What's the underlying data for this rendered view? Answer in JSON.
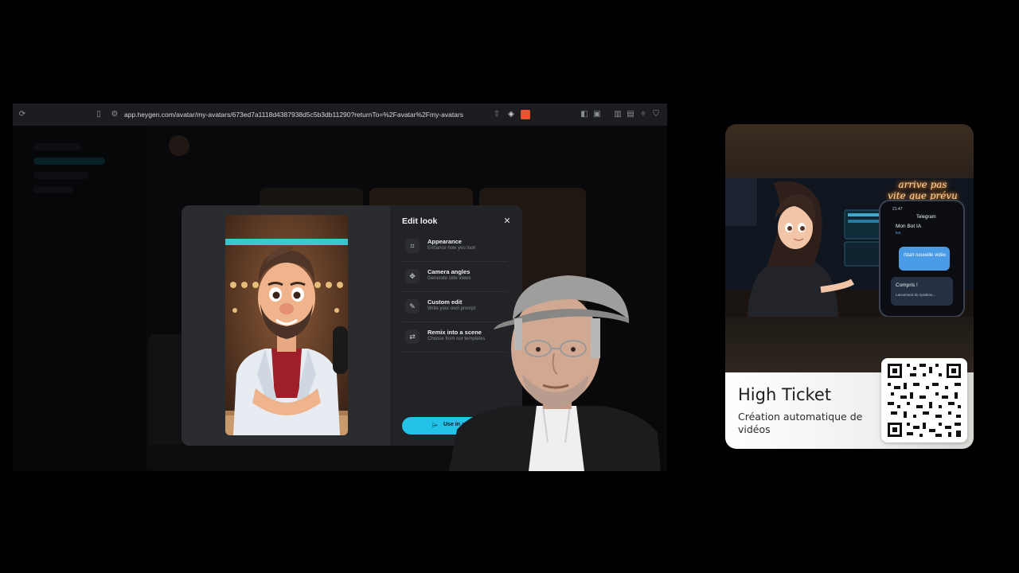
{
  "browser": {
    "url": "app.heygen.com/avatar/my-avatars/673ed7a1118d4387938d5c5b3db11290?returnTo=%2Favatar%2Fmy-avatars"
  },
  "modal": {
    "title": "Edit look",
    "options": [
      {
        "label": "Appearance",
        "desc": "Enhance how you look",
        "icon": "focus-frame-icon"
      },
      {
        "label": "Camera angles",
        "desc": "Generate side views",
        "icon": "camera-angles-icon"
      },
      {
        "label": "Custom edit",
        "desc": "Write your own prompt",
        "icon": "pen-edit-icon"
      },
      {
        "label": "Remix into a scene",
        "desc": "Choose from our templates",
        "icon": "swap-arrows-icon"
      }
    ],
    "use_button": "Use in a video",
    "accent": "#22c3e6"
  },
  "card": {
    "title": "High Ticket",
    "subtitle": "Création automatique de vidéos",
    "neon_text": [
      "arrive pas",
      "vite que prévu"
    ],
    "phone": {
      "time": "21:47",
      "app": "Telegram",
      "chat": "Mon Bot IA",
      "bot_label": "bot",
      "msg1": "/start nouvelle vidéo",
      "msg2": "Compris !",
      "msg3": "Lancement du système..."
    }
  }
}
